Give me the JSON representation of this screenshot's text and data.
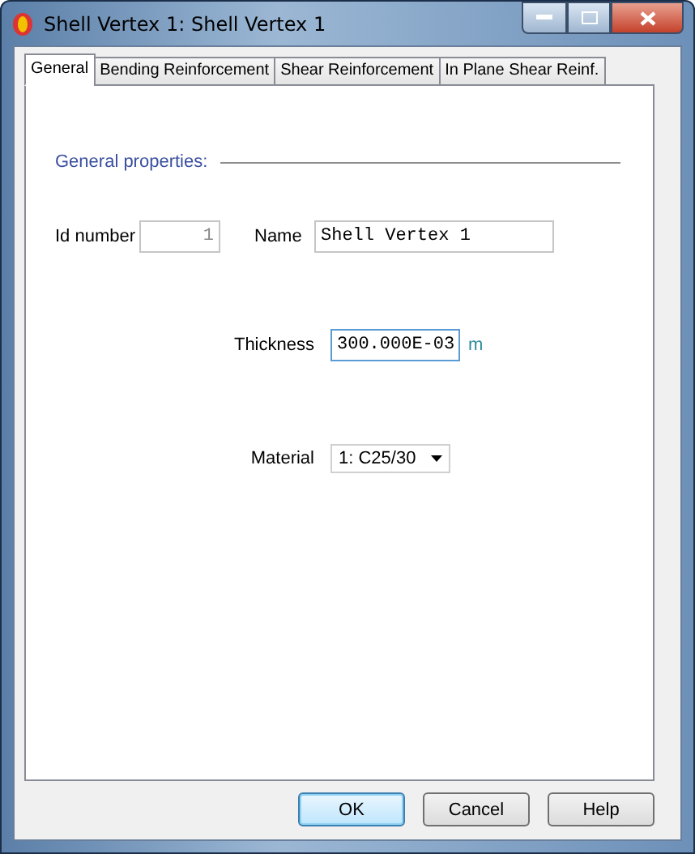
{
  "window": {
    "title": "Shell Vertex 1: Shell Vertex 1"
  },
  "tabs": [
    {
      "label": "General",
      "selected": true
    },
    {
      "label": "Bending Reinforcement",
      "selected": false
    },
    {
      "label": "Shear Reinforcement",
      "selected": false
    },
    {
      "label": "In Plane Shear Reinf.",
      "selected": false
    }
  ],
  "section": {
    "title": "General properties:"
  },
  "id_number": {
    "label": "Id number",
    "value": "1",
    "disabled": true
  },
  "name": {
    "label": "Name",
    "value": "Shell Vertex 1"
  },
  "thickness": {
    "label": "Thickness",
    "value": "300.000E-03",
    "unit": "m",
    "focused": true
  },
  "material": {
    "label": "Material",
    "value": "1: C25/30"
  },
  "buttons": [
    {
      "label": "OK",
      "default": true
    },
    {
      "label": "Cancel",
      "default": false
    },
    {
      "label": "Help",
      "default": false
    }
  ]
}
